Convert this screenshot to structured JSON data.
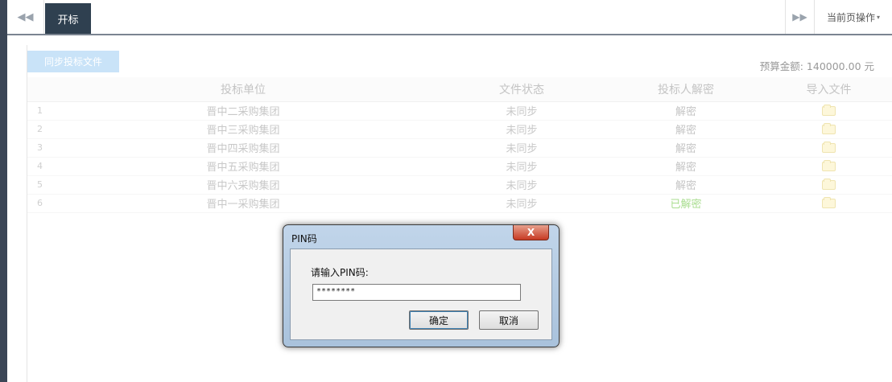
{
  "tabbar": {
    "nav_left_icon": "double-chevron-left-icon",
    "nav_left_glyph": "◀◀",
    "active_tab": "开标",
    "nav_right_icon": "double-chevron-right-icon",
    "nav_right_glyph": "▶▶",
    "page_ops_label": "当前页操作",
    "page_ops_caret": "▾"
  },
  "toolbar": {
    "sync_button_label": "同步投标文件",
    "budget_label": "预算金额: 140000.00 元"
  },
  "table": {
    "headers": [
      "投标单位",
      "文件状态",
      "投标人解密",
      "导入文件"
    ],
    "rows": [
      {
        "index": "1",
        "unit": "晋中二采购集团",
        "status": "未同步",
        "decrypt": "解密",
        "decrypted": false
      },
      {
        "index": "2",
        "unit": "晋中三采购集团",
        "status": "未同步",
        "decrypt": "解密",
        "decrypted": false
      },
      {
        "index": "3",
        "unit": "晋中四采购集团",
        "status": "未同步",
        "decrypt": "解密",
        "decrypted": false
      },
      {
        "index": "4",
        "unit": "晋中五采购集团",
        "status": "未同步",
        "decrypt": "解密",
        "decrypted": false
      },
      {
        "index": "5",
        "unit": "晋中六采购集团",
        "status": "未同步",
        "decrypt": "解密",
        "decrypted": false
      },
      {
        "index": "6",
        "unit": "晋中一采购集团",
        "status": "未同步",
        "decrypt": "已解密",
        "decrypted": true
      }
    ],
    "folder_icon": "folder-icon"
  },
  "dialog": {
    "title": "PIN码",
    "close_glyph": "X",
    "prompt": "请输入PIN码:",
    "pin_value": "********",
    "ok_label": "确定",
    "cancel_label": "取消"
  },
  "colors": {
    "sidebar": "#3b4656",
    "active_tab": "#2f4050",
    "sync_button": "#c9e3f8",
    "decrypted_text": "#a9dd8f"
  }
}
